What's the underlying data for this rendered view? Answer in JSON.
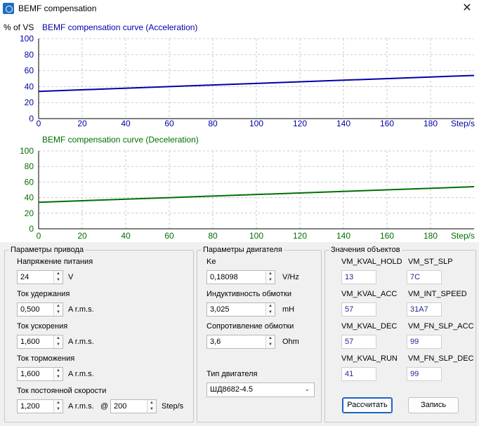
{
  "window": {
    "title": "BEMF compensation",
    "close_glyph": "✕"
  },
  "charts": {
    "y_caption": "% of VS",
    "x_unit": "Step/s"
  },
  "chart_data": [
    {
      "type": "line",
      "title": "BEMF compensation curve (Acceleration)",
      "x": [
        0,
        200
      ],
      "series": [
        {
          "values": [
            34,
            54
          ]
        }
      ],
      "xlim": [
        0,
        200
      ],
      "ylim": [
        0,
        100
      ],
      "xticks": [
        0,
        20,
        40,
        60,
        80,
        100,
        120,
        140,
        160,
        180
      ],
      "yticks": [
        0,
        20,
        40,
        60,
        80,
        100
      ],
      "xlabel": "Step/s",
      "ylabel": "% of VS",
      "grid": true,
      "color": "#0000aa"
    },
    {
      "type": "line",
      "title": "BEMF compensation curve (Deceleration)",
      "x": [
        0,
        200
      ],
      "series": [
        {
          "values": [
            34,
            54
          ]
        }
      ],
      "xlim": [
        0,
        200
      ],
      "ylim": [
        0,
        100
      ],
      "xticks": [
        0,
        20,
        40,
        60,
        80,
        100,
        120,
        140,
        160,
        180
      ],
      "yticks": [
        0,
        20,
        40,
        60,
        80,
        100
      ],
      "xlabel": "Step/s",
      "grid": true,
      "color": "#007000"
    }
  ],
  "drive": {
    "title": "Параметры привода",
    "supply_label": "Напряжение питания",
    "supply_value": "24",
    "supply_unit": "V",
    "hold_label": "Ток удержания",
    "hold_value": "0,500",
    "hold_unit": "A r.m.s.",
    "acc_label": "Ток ускорения",
    "acc_value": "1,600",
    "acc_unit": "A r.m.s.",
    "dec_label": "Ток торможения",
    "dec_value": "1,600",
    "dec_unit": "A r.m.s.",
    "run_label": "Ток постоянной скорости",
    "run_value": "1,200",
    "run_unit": "A r.m.s.",
    "at_sign": "@",
    "speed_value": "200",
    "speed_unit": "Step/s"
  },
  "motor": {
    "title": "Параметры двигателя",
    "ke_label": "Ke",
    "ke_value": "0,18098",
    "ke_unit": "V/Hz",
    "ind_label": "Индуктивность обмотки",
    "ind_value": "3,025",
    "ind_unit": "mH",
    "res_label": "Сопротивление обмотки",
    "res_value": "3,6",
    "res_unit": "Ohm",
    "type_label": "Тип двигателя",
    "type_value": "ШД8682-4.5"
  },
  "objects": {
    "title": "Значения объектов",
    "kval_hold_label": "VM_KVAL_HOLD",
    "kval_hold_value": "13",
    "st_slp_label": "VM_ST_SLP",
    "st_slp_value": "7C",
    "kval_acc_label": "VM_KVAL_ACC",
    "kval_acc_value": "57",
    "int_speed_label": "VM_INT_SPEED",
    "int_speed_value": "31A7",
    "kval_dec_label": "VM_KVAL_DEC",
    "kval_dec_value": "57",
    "fn_slp_acc_label": "VM_FN_SLP_ACC",
    "fn_slp_acc_value": "99",
    "kval_run_label": "VM_KVAL_RUN",
    "kval_run_value": "41",
    "fn_slp_dec_label": "VM_FN_SLP_DEC",
    "fn_slp_dec_value": "99",
    "calc_button": "Рассчитать",
    "write_button": "Запись"
  }
}
